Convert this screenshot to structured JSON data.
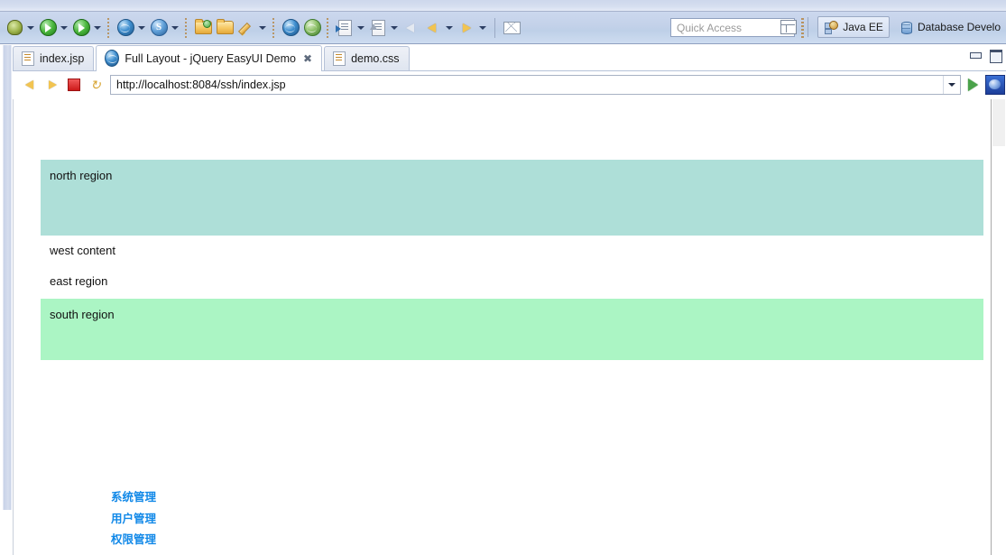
{
  "ide": {
    "toolbar_items": [
      {
        "name": "debug-bug-icon",
        "icon": "bug",
        "caret": true
      },
      {
        "name": "run-icon",
        "icon": "circle-green",
        "caret": true
      },
      {
        "name": "run-external-tools-icon",
        "icon": "circle-green-tools",
        "caret": true
      },
      {
        "name": "new-jsp-wizard-icon",
        "icon": "globe-star",
        "caret": true
      },
      {
        "name": "new-server-icon",
        "icon": "circle-blue-s",
        "caret": true
      },
      {
        "name": "open-project-icon",
        "icon": "folder-dot",
        "caret": false
      },
      {
        "name": "open-folder-icon",
        "icon": "folder",
        "caret": false
      },
      {
        "name": "edit-icon",
        "icon": "pencil",
        "caret": true
      },
      {
        "name": "open-web-browser-icon",
        "icon": "globe",
        "caret": false
      },
      {
        "name": "search-web-icon",
        "icon": "search-globe",
        "caret": false
      },
      {
        "name": "previous-annotation-icon",
        "icon": "doc-arrow",
        "caret": true
      },
      {
        "name": "next-annotation-icon",
        "icon": "doc-up",
        "caret": true
      },
      {
        "name": "back-disabled-icon",
        "icon": "arrow-left-pale",
        "caret": false
      },
      {
        "name": "back-icon",
        "icon": "arrow-left-gold",
        "caret": true
      },
      {
        "name": "forward-icon",
        "icon": "arrow-right-gold",
        "caret": true
      },
      {
        "name": "mail-icon",
        "icon": "mail",
        "caret": false
      }
    ],
    "quick_access": {
      "placeholder": "Quick Access",
      "value": ""
    },
    "perspective": {
      "open_perspective_label": "",
      "items": [
        {
          "label": "Java EE",
          "icon": "javaee-icon",
          "active": true
        },
        {
          "label": "Database Develo",
          "icon": "database-icon",
          "active": false
        }
      ]
    }
  },
  "editor": {
    "tabs": [
      {
        "label": "index.jsp",
        "icon": "jsp-file-icon",
        "active": false,
        "closable": false
      },
      {
        "label": "Full Layout - jQuery EasyUI Demo",
        "icon": "web-browser-icon",
        "active": true,
        "closable": true,
        "close_glyph": "✖"
      },
      {
        "label": "demo.css",
        "icon": "css-file-icon",
        "active": false,
        "closable": false
      }
    ],
    "window_controls": [
      {
        "name": "minimize-button",
        "label": "minimize"
      },
      {
        "name": "maximize-button",
        "label": "maximize"
      }
    ]
  },
  "browser": {
    "back_label": "Back",
    "forward_label": "Forward",
    "stop_label": "Stop",
    "refresh_label": "Refresh",
    "url": "http://localhost:8084/ssh/index.jsp",
    "url_placeholder": "",
    "go_label": "Go"
  },
  "page": {
    "regions": [
      {
        "name": "north",
        "text": "north region",
        "bg": "#aedfd8"
      },
      {
        "name": "west",
        "text": "west content",
        "bg": "#ffffff"
      },
      {
        "name": "east",
        "text": "east region",
        "bg": "#ffffff"
      },
      {
        "name": "south",
        "text": "south region",
        "bg": "#abf5c4"
      }
    ],
    "menu_links": [
      {
        "label": "系统管理",
        "color": "#1289e8"
      },
      {
        "label": "用户管理",
        "color": "#1289e8"
      },
      {
        "label": "权限管理",
        "color": "#1289e8"
      }
    ]
  },
  "colors": {
    "north_bg": "#aedfd8",
    "south_bg": "#abf5c4",
    "link_blue": "#1289e8",
    "toolbar_bg": "#c3d1e9"
  }
}
